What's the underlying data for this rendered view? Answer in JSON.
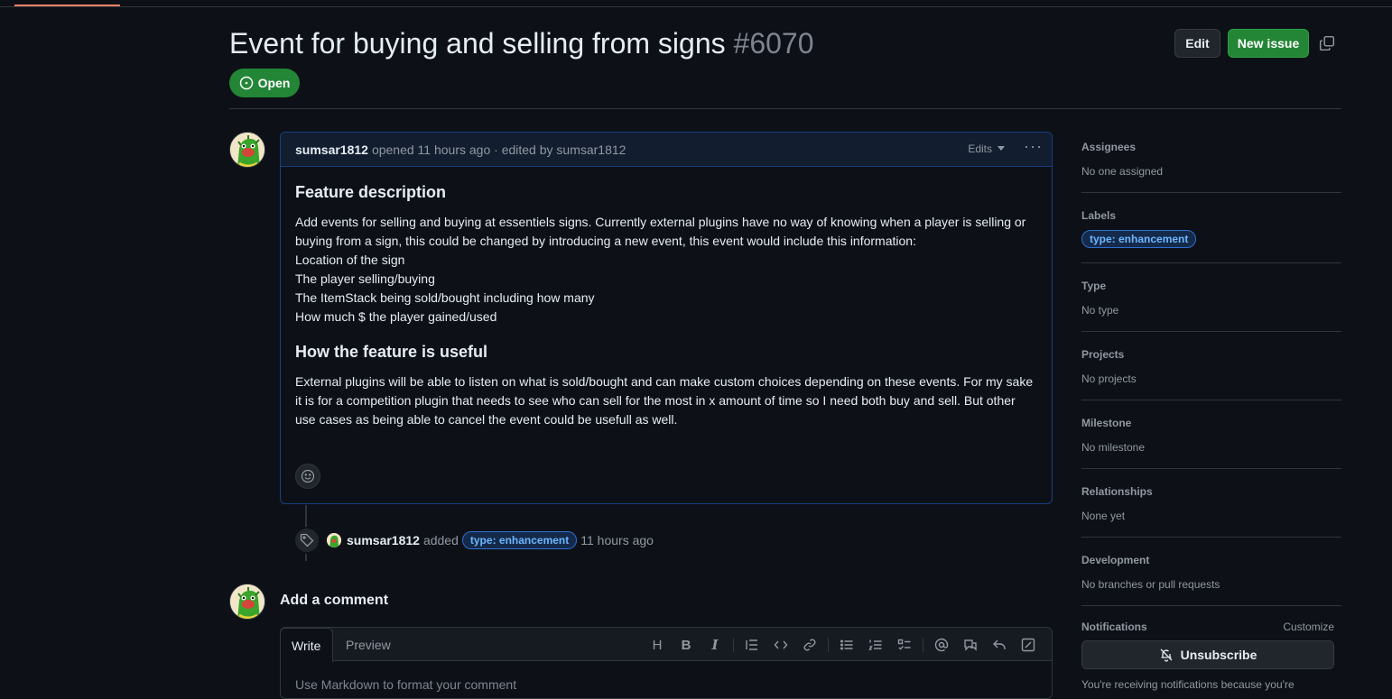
{
  "issue": {
    "title": "Event for buying and selling from signs",
    "number": "#6070",
    "state": "Open",
    "edit_label": "Edit",
    "new_issue_label": "New issue"
  },
  "comment": {
    "author": "sumsar1812",
    "meta": "opened 11 hours ago · edited by sumsar1812",
    "edits_label": "Edits",
    "heading1": "Feature description",
    "body_lines": [
      "Add events for selling and buying at essentiels signs. Currently external plugins have no way of knowing when a player is selling or",
      "buying from a sign, this could be changed by introducing a new event, this event would include this information:",
      "Location of the sign",
      "The player selling/buying",
      "The ItemStack being sold/bought including how many",
      "How much $ the player gained/used"
    ],
    "heading2": "How the feature is useful",
    "body2_lines": [
      "External plugins will be able to listen on what is sold/bought and can make custom choices depending on these events. For my sake",
      "it is for a competition plugin that needs to see who can sell for the most in x amount of time so I need both buy and sell. But other",
      "use cases as being able to cancel the event could be usefull as well."
    ]
  },
  "event": {
    "author": "sumsar1812",
    "action": "added",
    "label": "type: enhancement",
    "time": "11 hours ago"
  },
  "add_comment": {
    "title": "Add a comment",
    "tab_write": "Write",
    "tab_preview": "Preview",
    "placeholder": "Use Markdown to format your comment"
  },
  "sidebar": {
    "assignees": {
      "head": "Assignees",
      "value": "No one assigned"
    },
    "labels": {
      "head": "Labels",
      "value": "type: enhancement"
    },
    "type": {
      "head": "Type",
      "value": "No type"
    },
    "projects": {
      "head": "Projects",
      "value": "No projects"
    },
    "milestone": {
      "head": "Milestone",
      "value": "No milestone"
    },
    "relationships": {
      "head": "Relationships",
      "value": "None yet"
    },
    "development": {
      "head": "Development",
      "value": "No branches or pull requests"
    },
    "notifications": {
      "head": "Notifications",
      "customize": "Customize",
      "unsubscribe": "Unsubscribe",
      "note": "You're receiving notifications because you're"
    }
  },
  "colors": {
    "background": "#0d1117",
    "open_green": "#238636",
    "label_blue": "#6cb6ff"
  }
}
